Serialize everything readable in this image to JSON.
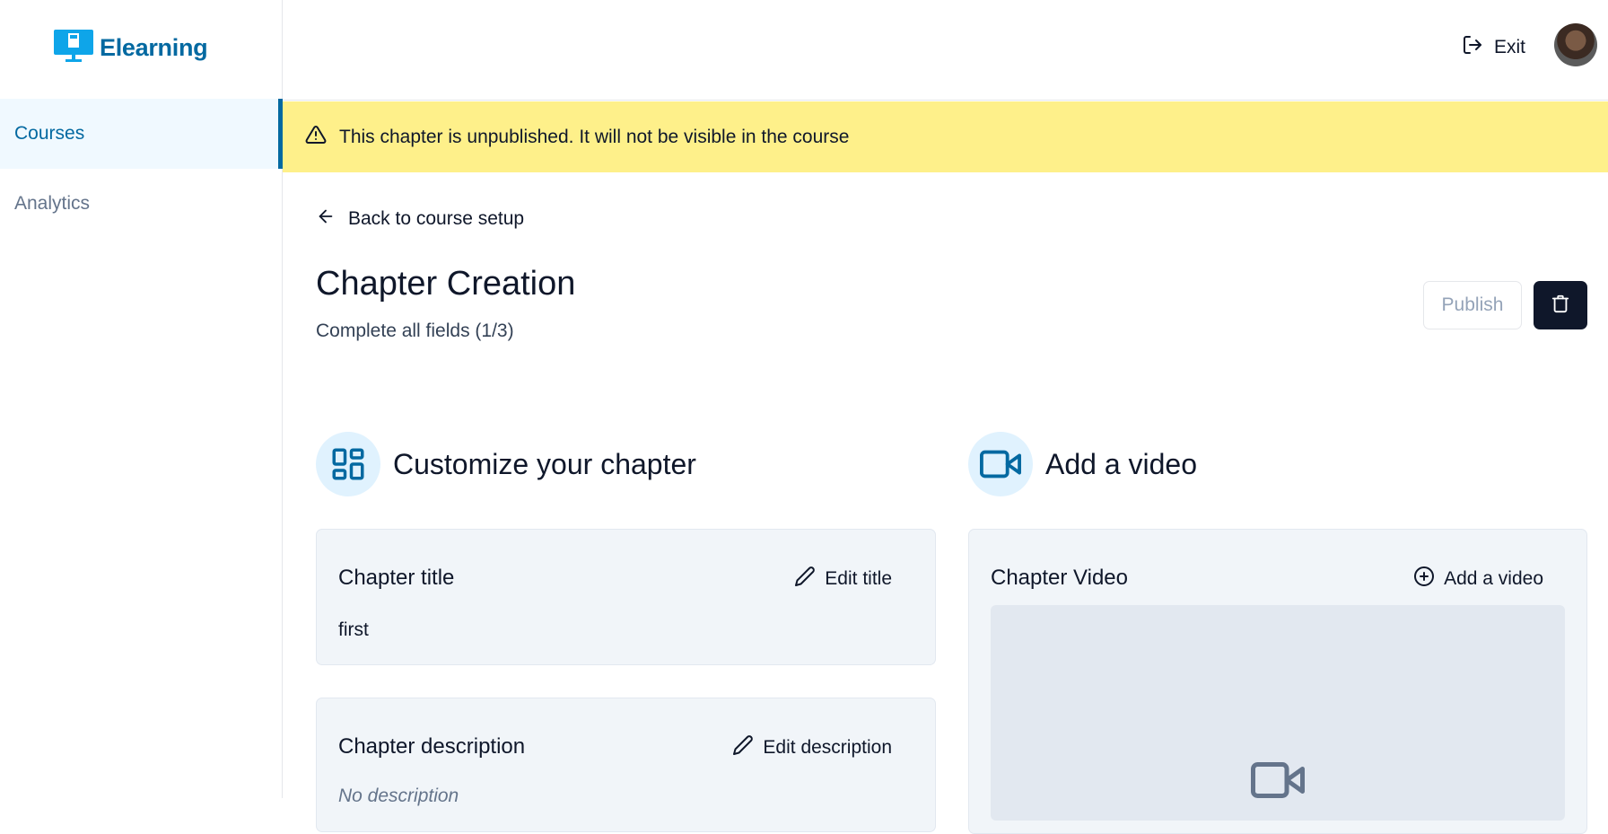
{
  "app": {
    "name": "Elearning"
  },
  "sidebar": {
    "items": [
      {
        "label": "Courses",
        "active": true
      },
      {
        "label": "Analytics",
        "active": false
      }
    ]
  },
  "header": {
    "exit_label": "Exit"
  },
  "banner": {
    "text": "This chapter is unpublished. It will not be visible in the course"
  },
  "page": {
    "back_label": "Back to course setup",
    "title": "Chapter Creation",
    "subtitle": "Complete all fields (1/3)",
    "publish_label": "Publish"
  },
  "customize": {
    "heading": "Customize your chapter",
    "title_card": {
      "label": "Chapter title",
      "action": "Edit title",
      "value": "first"
    },
    "description_card": {
      "label": "Chapter description",
      "action": "Edit description",
      "value": "No description"
    }
  },
  "video": {
    "heading": "Add a video",
    "card": {
      "label": "Chapter Video",
      "action": "Add a video"
    }
  },
  "colors": {
    "brand": "#0369a1",
    "banner": "#fef08a",
    "icon_bg": "#e0f2fe",
    "card_bg": "#f1f5f9",
    "dark_button": "#0f172a"
  }
}
